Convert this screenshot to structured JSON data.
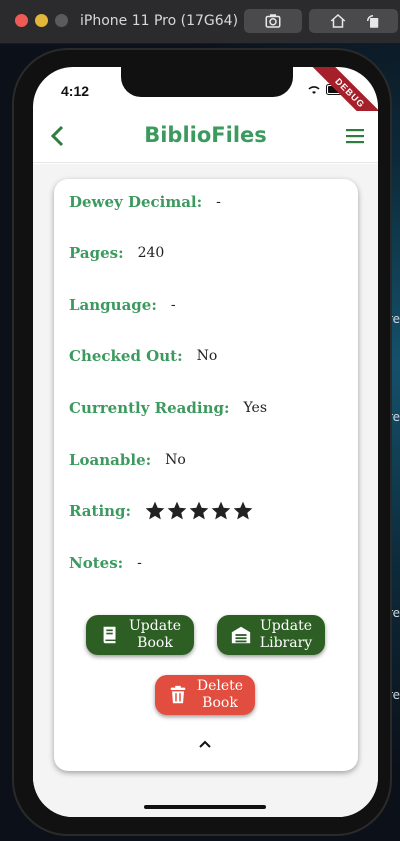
{
  "simulator": {
    "title": "iPhone 11 Pro (17G64)",
    "buttons": [
      "screenshot-icon",
      "home-icon",
      "rotate-icon"
    ]
  },
  "status_bar": {
    "time": "4:12",
    "debug": "DEBUG"
  },
  "appbar": {
    "title": "BiblioFiles",
    "back_icon": "back-arrow-icon",
    "menu_icon": "menu-icon"
  },
  "details": [
    {
      "label": "Dewey Decimal:",
      "value": "-"
    },
    {
      "label": "Pages:",
      "value": "240"
    },
    {
      "label": "Language:",
      "value": "-"
    },
    {
      "label": "Checked Out:",
      "value": "No"
    },
    {
      "label": "Currently Reading:",
      "value": "Yes"
    },
    {
      "label": "Loanable:",
      "value": "No"
    },
    {
      "label": "Rating:",
      "value": ""
    },
    {
      "label": "Notes:",
      "value": "-"
    }
  ],
  "rating": {
    "value": 5,
    "max": 5
  },
  "buttons": {
    "update_book": "Update\nBook",
    "update_library": "Update\nLibrary",
    "delete_book": "Delete\nBook"
  },
  "colors": {
    "accent": "#3c9a5f",
    "button_green": "#2d5e24",
    "button_red": "#e14d3e"
  }
}
